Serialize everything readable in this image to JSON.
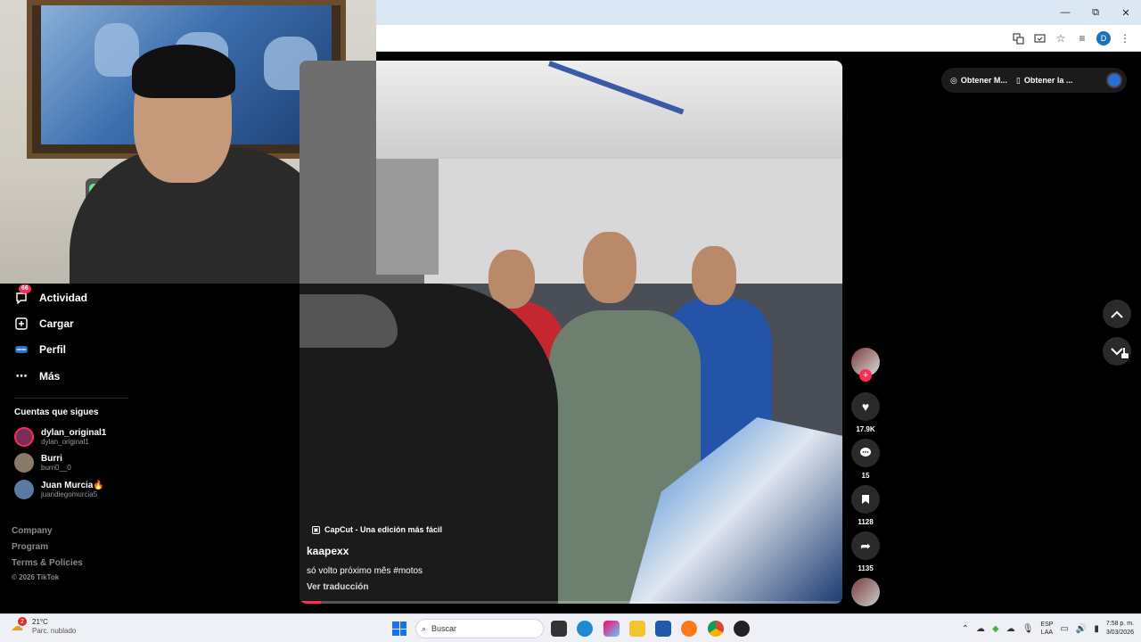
{
  "browser": {
    "controls": {
      "minimize": "—",
      "restore": "⧉",
      "close": "✕"
    },
    "profile_initial": "D",
    "toolbar_icons": [
      "translate-icon",
      "cast-icon",
      "star-icon",
      "media-icon",
      "profile-icon",
      "menu-icon"
    ]
  },
  "sidebar": {
    "nav": [
      {
        "label": "Actividad",
        "icon": "activity-icon",
        "badge": "66"
      },
      {
        "label": "Cargar",
        "icon": "upload-icon"
      },
      {
        "label": "Perfil",
        "icon": "profile-icon"
      },
      {
        "label": "Más",
        "icon": "more-icon"
      }
    ],
    "following_title": "Cuentas que sigues",
    "accounts": [
      {
        "name": "dylan_original1",
        "handle": "dylan_original1",
        "live": "LIVE"
      },
      {
        "name": "Burri",
        "handle": "burri0__0"
      },
      {
        "name": "Juan Murcia🔥",
        "handle": "juandiegomurcia5"
      }
    ],
    "footer": [
      "Company",
      "Program",
      "Terms & Policies",
      "© 2026 TikTok"
    ]
  },
  "video": {
    "capcut": "CapCut - Una edición más fácil",
    "username": "kaapexx",
    "description": "só volto próximo mês #motos",
    "translate": "Ver traducción",
    "progress": 0.04
  },
  "actions": {
    "likes": "17.9K",
    "comments": "15",
    "saves": "1128",
    "shares": "1135"
  },
  "top_right": {
    "item1": "Obtener M...",
    "item2": "Obtener la ..."
  },
  "taskbar": {
    "weather_temp": "21°C",
    "weather_desc": "Parc. nublado",
    "weather_badge": "2",
    "search": "Buscar",
    "lang1": "ESP",
    "lang2": "LAA",
    "time": "7:58 p. m.",
    "date": "3/03/2026"
  },
  "colors": {
    "accent": "#fe2c55",
    "chrome_tab": "#dce7f6",
    "taskbar": "#eef0f5"
  }
}
